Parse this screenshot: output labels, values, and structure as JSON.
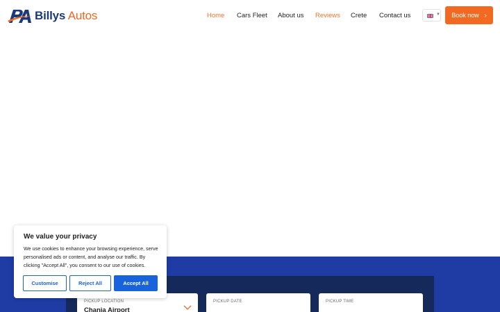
{
  "brand": {
    "name_part1": "Billys",
    "name_part2": "Autos",
    "colors": {
      "navy": "#1c3a7a",
      "orange": "#f26722"
    }
  },
  "nav": {
    "items": [
      {
        "label": "Home",
        "active": true
      },
      {
        "label": "Cars Fleet",
        "active": false
      },
      {
        "label": "About us",
        "active": false
      },
      {
        "label": "Reviews",
        "active": true
      },
      {
        "label": "Crete",
        "active": false
      },
      {
        "label": "Contact us",
        "active": false
      }
    ],
    "active_color": "#e9762b"
  },
  "language": {
    "icon": "uk-flag-icon",
    "caret_icon": "chevron-down-icon"
  },
  "header": {
    "book_label": "Book now",
    "book_icon": "chevron-right-icon",
    "book_color": "#f26a21"
  },
  "booking": {
    "band_color": "#1e3ca4",
    "panel_color": "#152a5a",
    "fields": [
      {
        "label": "PICKUP LOCATION",
        "value": "Chania Airport"
      },
      {
        "label": "PICKUP DATE",
        "value": ""
      },
      {
        "label": "PICKUP TIME",
        "value": ""
      }
    ]
  },
  "cookie": {
    "title": "We value your privacy",
    "text": "We use cookies to enhance your browsing experience, serve personalised ads or content, and analyse our traffic. By clicking \"Accept All\", you consent to our use of cookies.",
    "customise_label": "Customise",
    "reject_label": "Reject All",
    "accept_label": "Accept All",
    "accent": "#1863dc"
  }
}
